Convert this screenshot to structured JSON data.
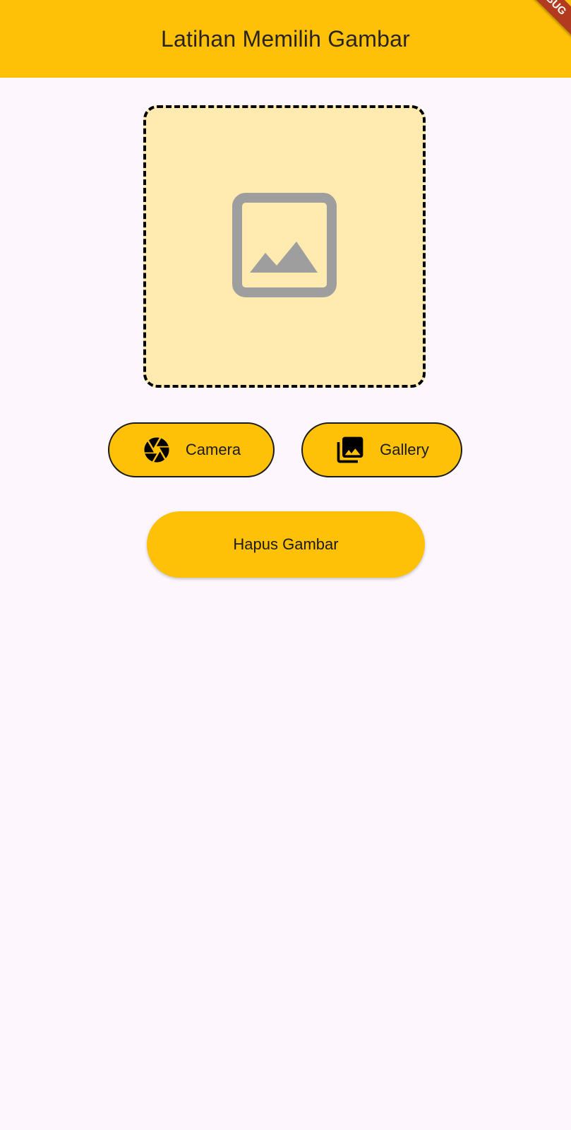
{
  "app_bar": {
    "title": "Latihan Memilih Gambar",
    "background": "#ffc107"
  },
  "debug_banner": {
    "label": "DEBUG"
  },
  "image_preview": {
    "icon": "image-placeholder-icon",
    "background": "#ffebb0",
    "border_style": "dashed"
  },
  "actions": {
    "camera": {
      "label": "Camera",
      "icon": "camera-icon"
    },
    "gallery": {
      "label": "Gallery",
      "icon": "photo-library-icon"
    },
    "delete": {
      "label": "Hapus Gambar"
    }
  },
  "colors": {
    "accent": "#ffc107",
    "page_background": "#fdf7fd",
    "placeholder_icon": "#9e9e9e"
  }
}
